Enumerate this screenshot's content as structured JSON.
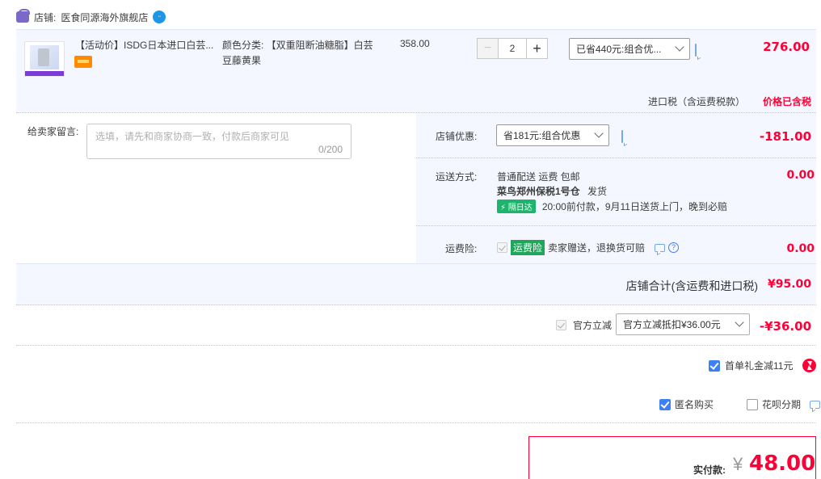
{
  "shop": {
    "label": "店铺:",
    "name": "医食同源海外旗舰店"
  },
  "item": {
    "title": "【活动价】ISDG日本进口白芸...",
    "sku": "颜色分类: 【双重阻断油糖脂】白芸豆藤黄果",
    "unit_price": "358.00",
    "quantity": "2",
    "promo_select": "已省440元:组合优...",
    "subtotal": "276.00",
    "tax_label": "进口税（含运费税款）",
    "tax_value": "价格已含税"
  },
  "message": {
    "label": "给卖家留言:",
    "placeholder": "选填，请先和商家协商一致，付款后商家可见",
    "count": "0/200"
  },
  "shop_discount": {
    "label": "店铺优惠:",
    "select": "省181元:组合优惠",
    "value": "-181.00"
  },
  "shipping": {
    "label": "运送方式:",
    "line1": "普通配送 运费 包邮",
    "line2_warehouse": "菜鸟郑州保税1号仓",
    "line2_ship": "发货",
    "badge": "隔日达",
    "line3": "20:00前付款，9月11日送货上门，晚到必赔",
    "value": "0.00"
  },
  "insurance": {
    "label": "运费险:",
    "badge": "运费险",
    "text": "卖家赠送，退换货可赔",
    "value": "0.00"
  },
  "shop_total": {
    "label": "店铺合计(含运费和进口税)",
    "value": "¥95.00"
  },
  "official": {
    "label": "官方立减",
    "select": "官方立减抵扣¥36.00元",
    "value": "-¥36.00"
  },
  "first_order": {
    "label": "首单礼金减11元"
  },
  "anonymous": {
    "label": "匿名购买"
  },
  "huabei": {
    "label": "花呗分期"
  },
  "pay": {
    "label": "实付款:",
    "currency": "¥",
    "value": "48.00"
  },
  "colors": {
    "accent": "#ff0036",
    "panel": "#f4f7ff",
    "link": "#3d7ff5"
  }
}
